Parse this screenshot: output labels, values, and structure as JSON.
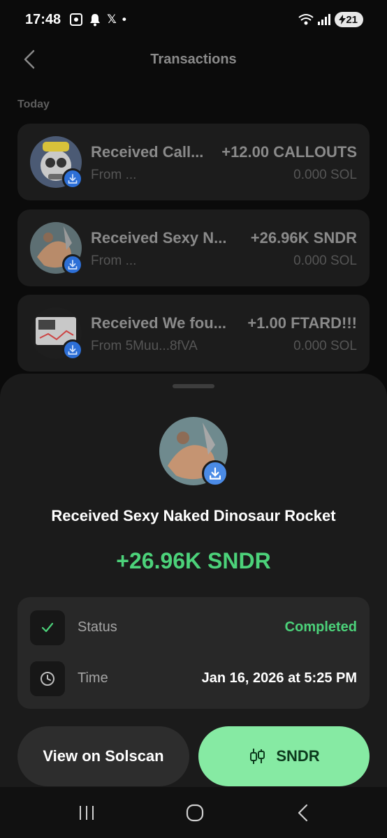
{
  "status_bar": {
    "time": "17:48",
    "left_icons": [
      "screenshot-icon",
      "bell-icon",
      "x-icon",
      "dot-icon"
    ],
    "x_glyph": "𝕏",
    "dot_glyph": "•",
    "battery": "21"
  },
  "header": {
    "title": "Transactions"
  },
  "section": {
    "today": "Today"
  },
  "transactions": [
    {
      "title": "Received Call...",
      "amount": "+12.00 CALLOUTS",
      "from": "From ...",
      "sol": "0.000 SOL"
    },
    {
      "title": "Received Sexy N...",
      "amount": "+26.96K SNDR",
      "from": "From ...",
      "sol": "0.000 SOL"
    },
    {
      "title": "Received We fou...",
      "amount": "+1.00 FTARD!!!",
      "from": "From 5Muu...8fVA",
      "sol": "0.000 SOL"
    }
  ],
  "sheet": {
    "title": "Received Sexy Naked Dinosaur Rocket",
    "amount": "+26.96K SNDR",
    "details": {
      "status_label": "Status",
      "status_value": "Completed",
      "time_label": "Time",
      "time_value": "Jan 16, 2026 at 5:25 PM"
    },
    "buttons": {
      "solscan": "View on Solscan",
      "token": "SNDR"
    }
  },
  "colors": {
    "accent_green": "#4cd27a",
    "button_green": "#86eaa3",
    "badge_blue": "#4b8be6"
  }
}
